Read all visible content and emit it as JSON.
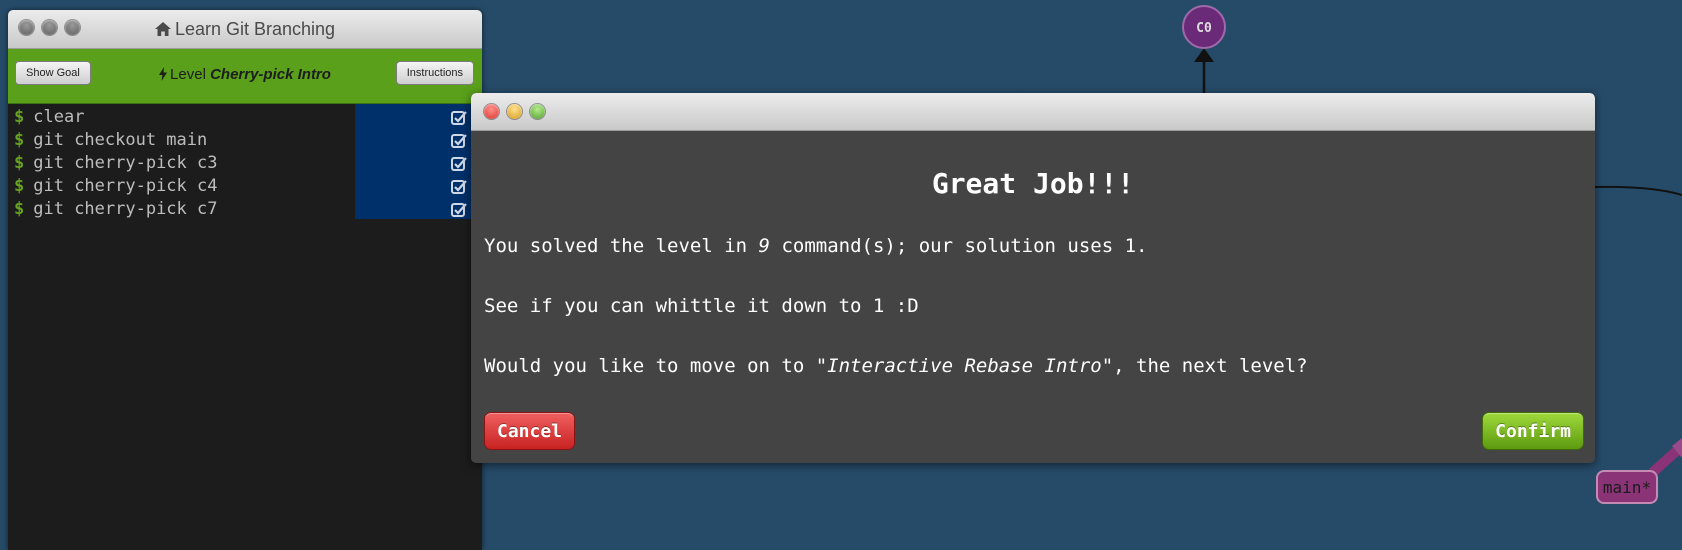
{
  "terminal": {
    "title": "Learn Git Branching",
    "show_goal_label": "Show Goal",
    "level_prefix": "Level",
    "level_name": "Cherry-pick Intro",
    "instructions_label": "Instructions",
    "prompt": "$",
    "commands": [
      "clear",
      "git checkout main",
      "git cherry-pick c3",
      "git cherry-pick c4",
      "git cherry-pick c7"
    ]
  },
  "graph": {
    "commit_label": "C0",
    "branch_label": "main*"
  },
  "modal": {
    "heading": "Great Job!!!",
    "p1_before": "You solved the level in ",
    "p1_count": "9",
    "p1_after": " command(s); our solution uses 1.",
    "p2": "See if you can whittle it down to 1 :D",
    "p3_before": "Would you like to move on to ",
    "p3_level": "\"Interactive Rebase Intro\"",
    "p3_after": ", the next level?",
    "cancel_label": "Cancel",
    "confirm_label": "Confirm"
  },
  "colors": {
    "background": "#264b69",
    "level_bar": "#5aa01b",
    "commit": "#6a2a78",
    "branch": "#8a3477"
  }
}
